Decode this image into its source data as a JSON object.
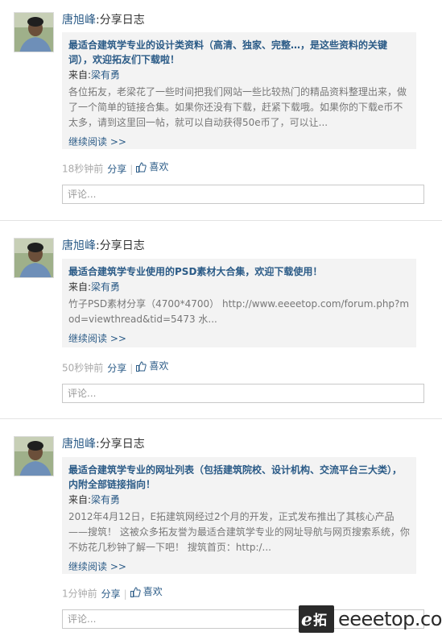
{
  "feed": [
    {
      "author": "唐旭峰",
      "action": ":分享日志",
      "title": "最适合建筑学专业的设计类资料（高清、独家、完整…，是这些资料的关键词），欢迎拓友们下载啦！",
      "from_label": "来自:",
      "from_name": "梁有勇",
      "excerpt": "各位拓友，老梁花了一些时间把我们网站一些比较热门的精品资料整理出来，做了一个简单的链接合集。如果你还没有下载，赶紧下载哦。如果你的下载e币不太多，请到这里回一帖，就可以自动获得50e币了，可以让...",
      "read_more": "继续阅读 >>",
      "time": "18秒钟前",
      "share_label": "分享",
      "separator": "|",
      "like_label": "喜欢",
      "comment_placeholder": "评论..."
    },
    {
      "author": "唐旭峰",
      "action": ":分享日志",
      "title": "最适合建筑学专业使用的PSD素材大合集，欢迎下载使用！",
      "from_label": "来自:",
      "from_name": "梁有勇",
      "excerpt": "竹子PSD素材分享（4700*4700） http://www.eeeetop.com/forum.php?mod=viewthread&tid=5473 水...",
      "read_more": "继续阅读 >>",
      "time": "50秒钟前",
      "share_label": "分享",
      "separator": "|",
      "like_label": "喜欢",
      "comment_placeholder": "评论..."
    },
    {
      "author": "唐旭峰",
      "action": ":分享日志",
      "title": "最适合建筑学专业的网址列表（包括建筑院校、设计机构、交流平台三大类），内附全部链接指向！",
      "from_label": "来自:",
      "from_name": "梁有勇",
      "excerpt": "2012年4月12日，E拓建筑网经过2个月的开发，正式发布推出了其核心产品——搜筑！ 这被众多拓友誉为最适合建筑学专业的网址导航与网页搜索系统，你不妨花几秒钟了解一下吧！ 搜筑首页：http:/...",
      "read_more": "继续阅读 >>",
      "time": "1分钟前",
      "share_label": "分享",
      "separator": "|",
      "like_label": "喜欢",
      "comment_placeholder": "评论..."
    }
  ],
  "watermark": {
    "badge_text": "e拓",
    "site_text": "eeeetop.com"
  },
  "colors": {
    "link": "#2b5b87",
    "share_box_bg": "#f3f3f3",
    "muted_text": "#777777",
    "time_text": "#aaaaaa"
  }
}
